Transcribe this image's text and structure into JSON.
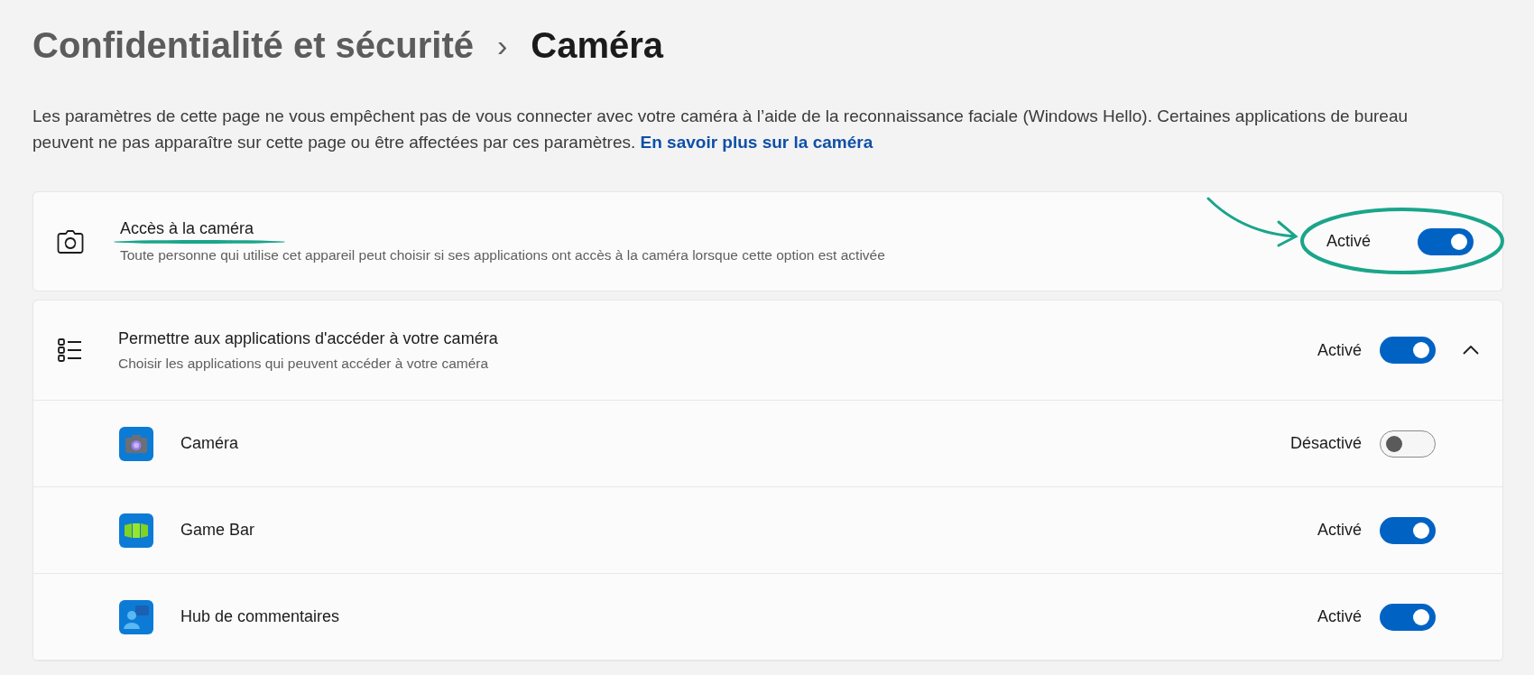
{
  "breadcrumb": {
    "parent": "Confidentialité et sécurité",
    "separator": "›",
    "current": "Caméra"
  },
  "description": {
    "text": "Les paramètres de cette page ne vous empêchent pas de vous connecter avec votre caméra à l’aide de la reconnaissance faciale (Windows Hello). Certaines applications de bureau peuvent ne pas apparaître sur cette page ou être affectées par ces paramètres.",
    "link": "En savoir plus sur la caméra"
  },
  "camera_access": {
    "title": "Accès à la caméra",
    "subtitle": "Toute personne qui utilise cet appareil peut choisir si ses applications ont accès à la caméra lorsque cette option est activée",
    "status": "Activé",
    "on": true
  },
  "app_access": {
    "title": "Permettre aux applications d'accéder à votre caméra",
    "subtitle": "Choisir les applications qui peuvent accéder à votre caméra",
    "status": "Activé",
    "on": true,
    "expanded": true,
    "apps": [
      {
        "kind": "camera",
        "name": "Caméra",
        "status": "Désactivé",
        "on": false
      },
      {
        "kind": "gamebar",
        "name": "Game Bar",
        "status": "Activé",
        "on": true
      },
      {
        "kind": "feedback",
        "name": "Hub de commentaires",
        "status": "Activé",
        "on": true
      }
    ]
  }
}
